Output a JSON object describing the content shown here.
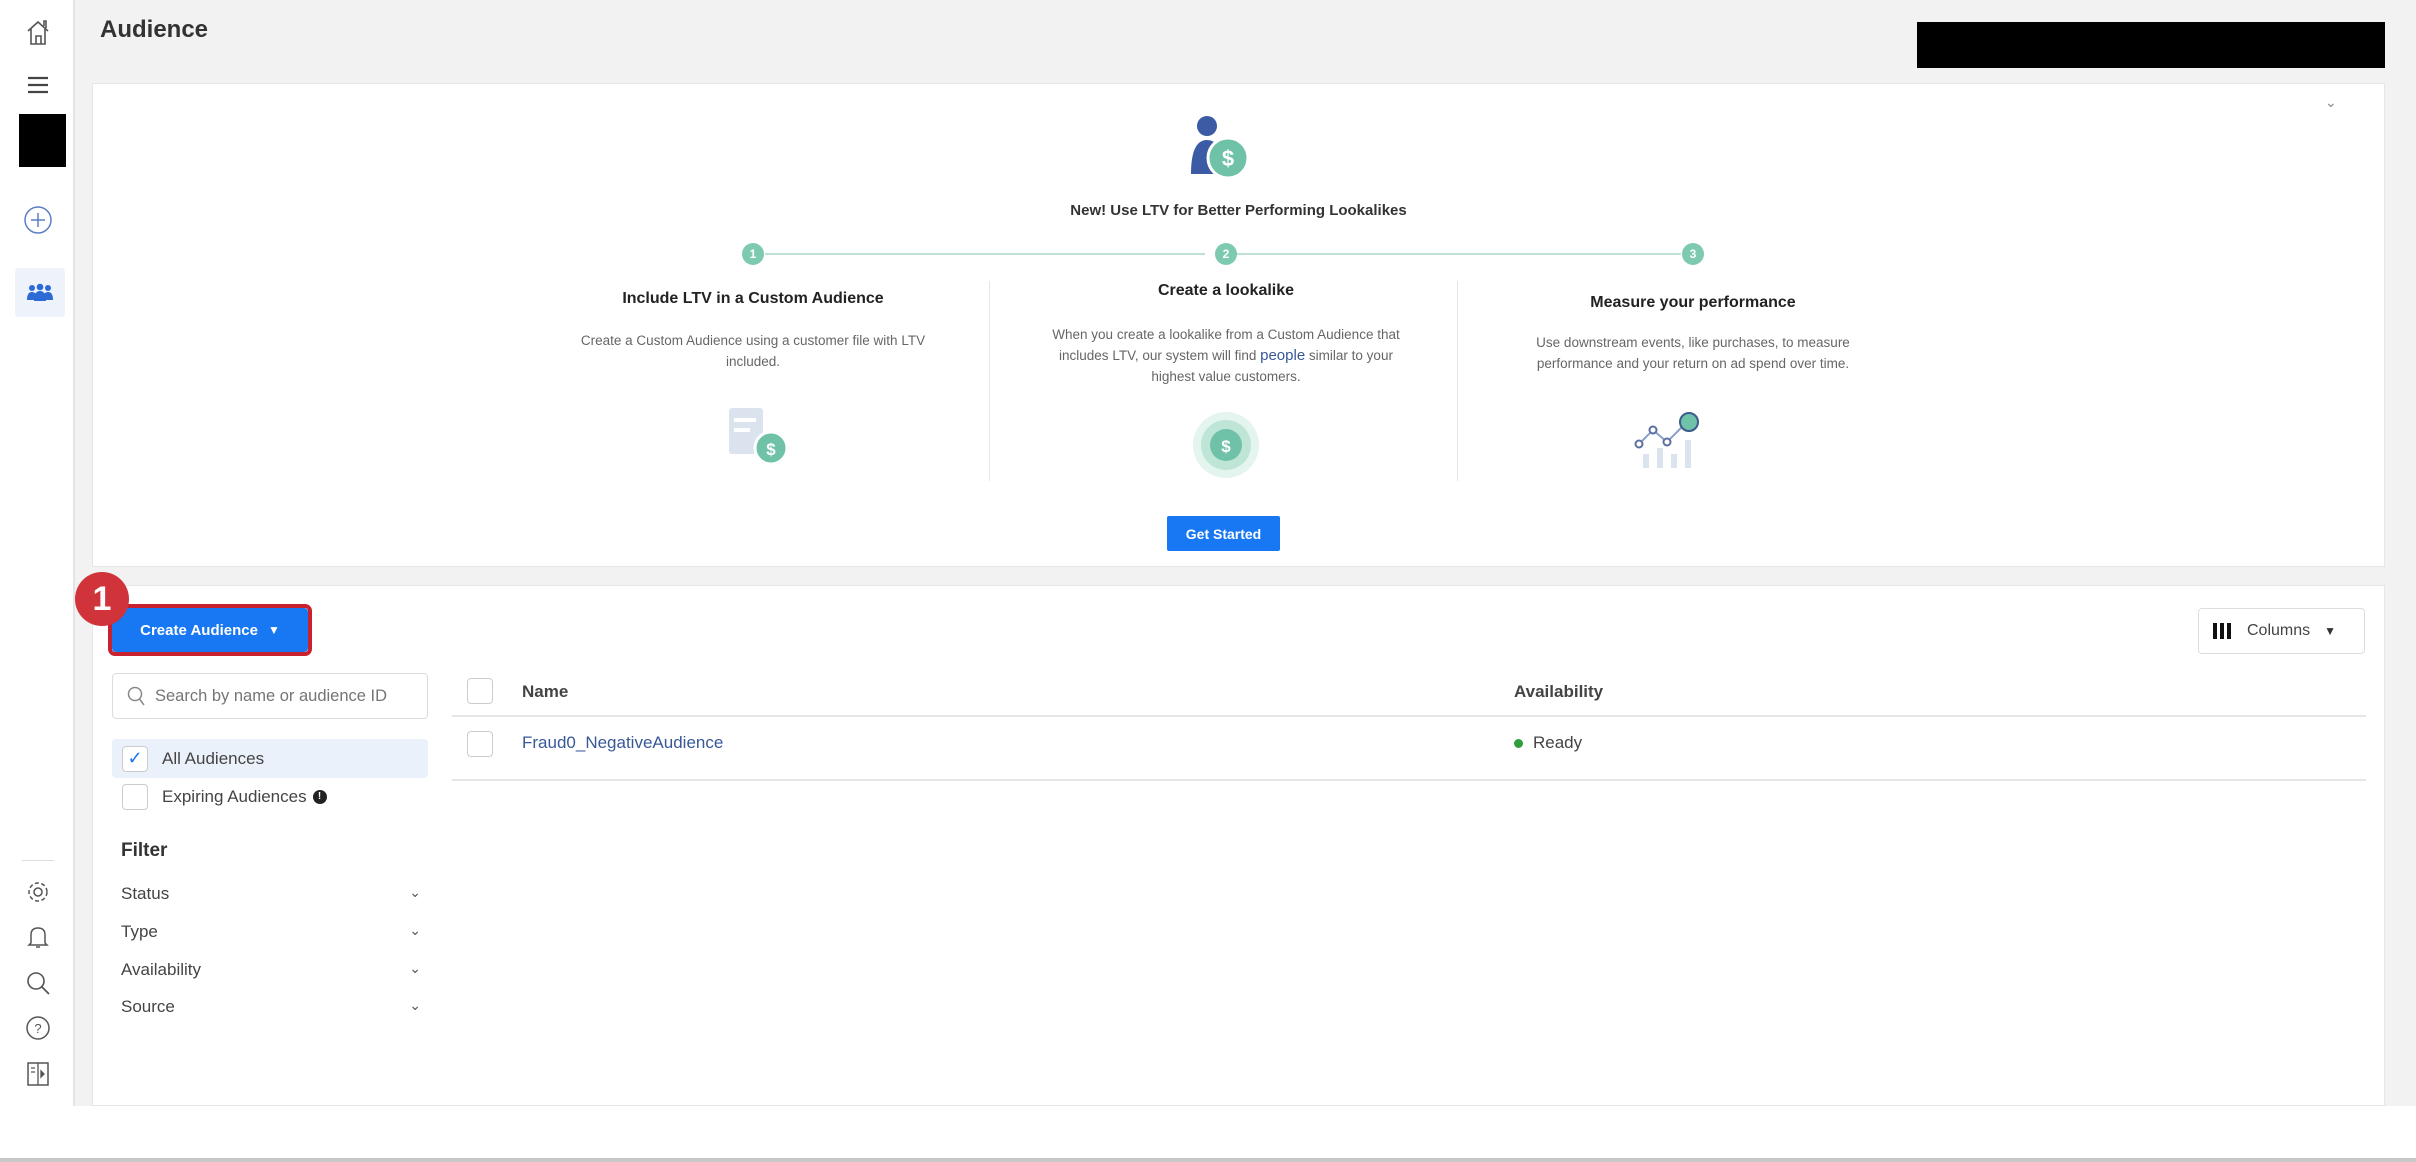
{
  "header": {
    "title": "Audience"
  },
  "sidebar": {
    "items": [
      {
        "icon": "home-icon"
      },
      {
        "icon": "menu-icon"
      },
      {
        "icon": "create-icon"
      },
      {
        "icon": "audience-icon",
        "active": true
      },
      {
        "icon": "gear-icon"
      },
      {
        "icon": "bell-icon"
      },
      {
        "icon": "search-icon"
      },
      {
        "icon": "help-icon"
      },
      {
        "icon": "panel-icon"
      }
    ]
  },
  "banner": {
    "title": "New! Use LTV for Better Performing Lookalikes",
    "steps": [
      {
        "number": "1",
        "title": "Include LTV in a Custom Audience",
        "description": "Create a Custom Audience using a customer file with LTV included."
      },
      {
        "number": "2",
        "title": "Create a lookalike",
        "description_pre": "When you create a lookalike from a Custom Audience that includes LTV, our system will find ",
        "description_link": "people",
        "description_post": " similar to your highest value customers."
      },
      {
        "number": "3",
        "title": "Measure your performance",
        "description": "Use downstream events, like purchases, to measure performance and your return on ad spend over time."
      }
    ],
    "cta": "Get Started",
    "accent": "#7ecab0"
  },
  "toolbar": {
    "annotation_badge": "1",
    "create_audience": "Create Audience",
    "columns": "Columns"
  },
  "filters": {
    "search_placeholder": "Search by name or audience ID",
    "all_audiences": "All Audiences",
    "all_checked": true,
    "expiring": "Expiring Audiences",
    "expiring_checked": false,
    "heading": "Filter",
    "items": [
      "Status",
      "Type",
      "Availability",
      "Source"
    ]
  },
  "table": {
    "columns": [
      "Name",
      "Availability"
    ],
    "rows": [
      {
        "name": "Fraud0_NegativeAudience",
        "availability": "Ready",
        "status_color": "#2e9e3a"
      }
    ]
  },
  "colors": {
    "primary": "#1877f2",
    "annotation": "#d0343a",
    "link": "#385898"
  }
}
